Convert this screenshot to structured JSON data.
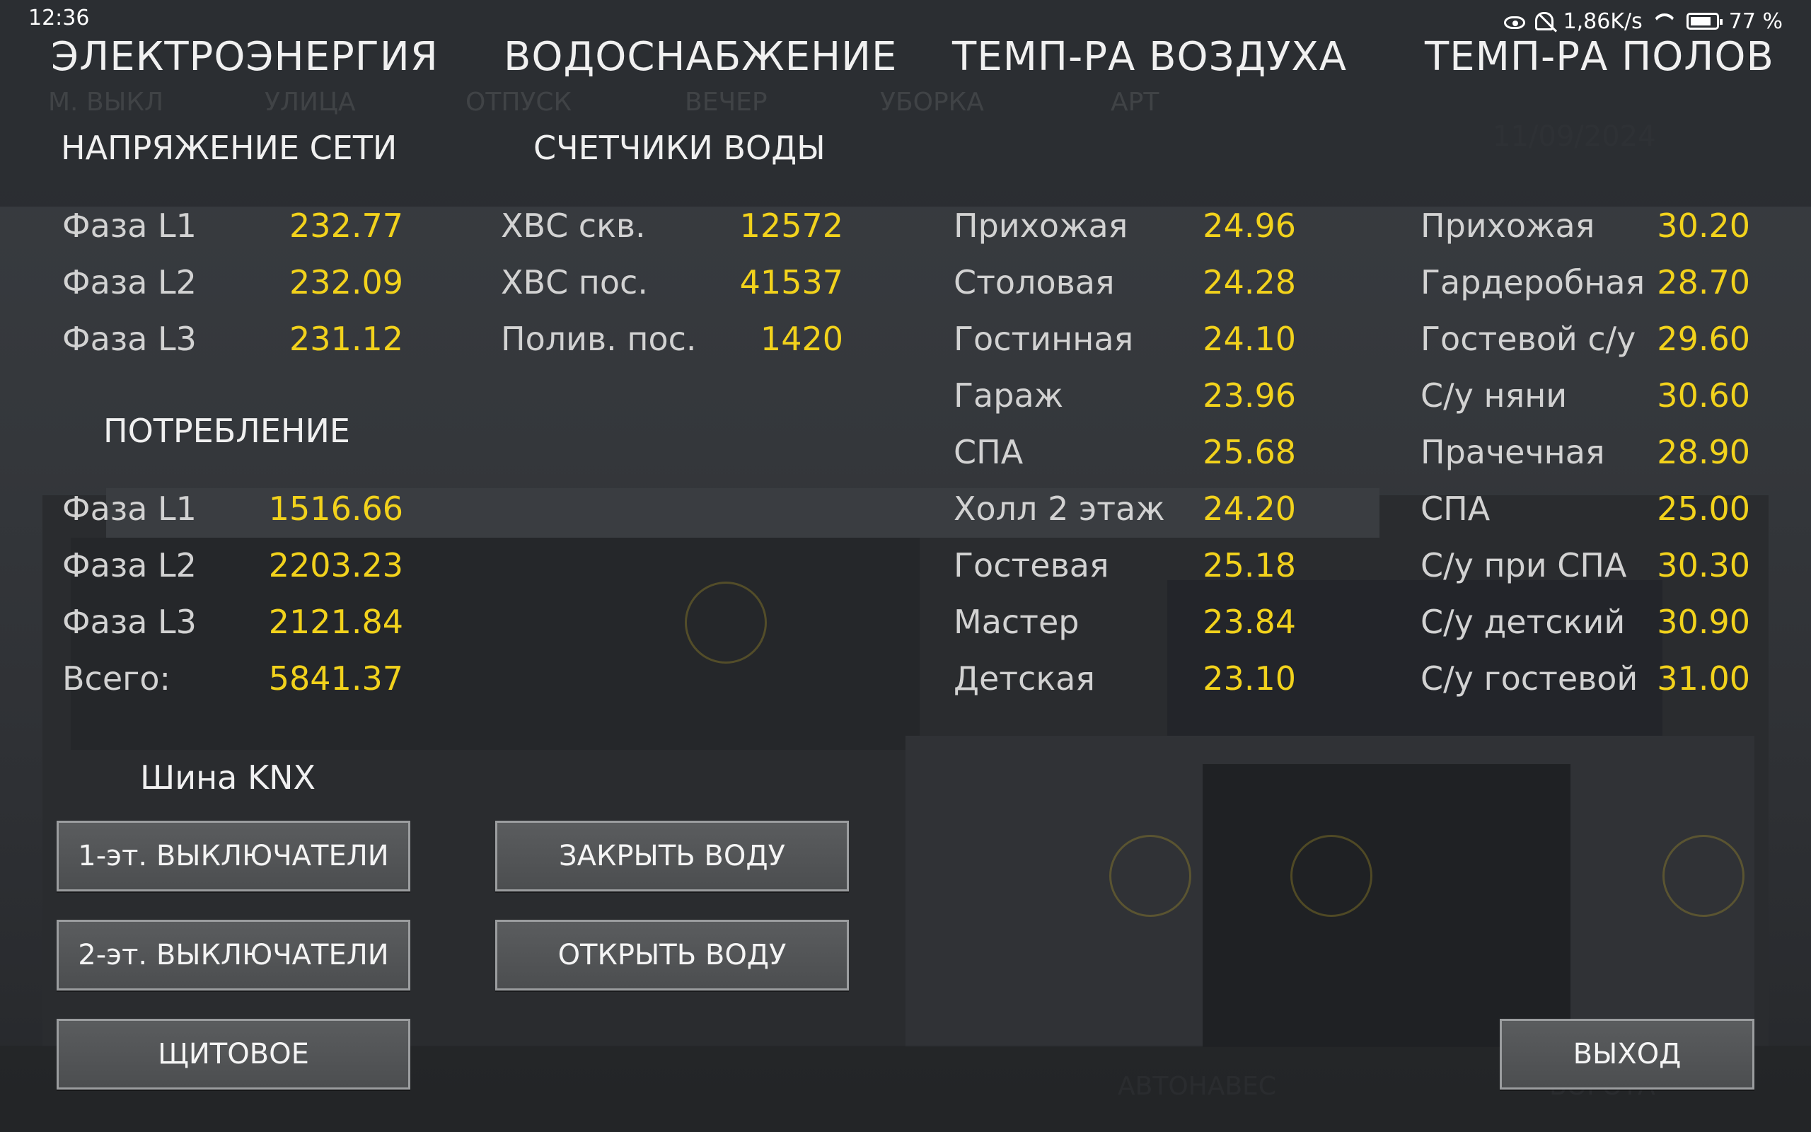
{
  "status_bar": {
    "time": "12:36",
    "net_speed": "1,86K/s",
    "battery": "77 %",
    "icons": [
      "eye-icon",
      "muted-bell-icon",
      "wifi-icon",
      "battery-icon"
    ]
  },
  "headers": {
    "electricity": "ЭЛЕКТРОЭНЕРГИЯ",
    "water": "ВОДОСНАБЖЕНИЕ",
    "air_temp": "ТЕМП-РА ВОЗДУХА",
    "floor_temp": "ТЕМП-РА ПОЛОВ"
  },
  "background_tabs": [
    "М. ВЫКЛ",
    "УЛИЦА",
    "ОТПУСК",
    "ВЕЧЕР",
    "УБОРКА",
    "АРТ"
  ],
  "voltage": {
    "title": "НАПРЯЖЕНИЕ СЕТИ",
    "rows": [
      {
        "label": "Фаза L1",
        "value": "232.77"
      },
      {
        "label": "Фаза L2",
        "value": "232.09"
      },
      {
        "label": "Фаза L3",
        "value": "231.12"
      }
    ]
  },
  "consumption": {
    "title": "ПОТРЕБЛЕНИЕ",
    "rows": [
      {
        "label": "Фаза L1",
        "value": "1516.66"
      },
      {
        "label": "Фаза L2",
        "value": "2203.23"
      },
      {
        "label": "Фаза L3",
        "value": "2121.84"
      },
      {
        "label": "Всего:",
        "value": "5841.37"
      }
    ]
  },
  "water_meters": {
    "title": "СЧЕТЧИКИ ВОДЫ",
    "rows": [
      {
        "label": "ХВС скв.",
        "value": "12572"
      },
      {
        "label": "ХВС пос.",
        "value": "41537"
      },
      {
        "label": "Полив. пос.",
        "value": "1420"
      }
    ]
  },
  "air_temps": [
    {
      "label": "Прихожая",
      "value": "24.96"
    },
    {
      "label": "Столовая",
      "value": "24.28"
    },
    {
      "label": "Гостинная",
      "value": "24.10"
    },
    {
      "label": "Гараж",
      "value": "23.96"
    },
    {
      "label": "СПА",
      "value": "25.68"
    },
    {
      "label": "Холл 2 этаж",
      "value": "24.20"
    },
    {
      "label": "Гостевая",
      "value": "25.18"
    },
    {
      "label": "Мастер",
      "value": "23.84"
    },
    {
      "label": "Детская",
      "value": "23.10"
    }
  ],
  "floor_temps": [
    {
      "label": "Прихожая",
      "value": "30.20"
    },
    {
      "label": "Гардеробная",
      "value": "28.70"
    },
    {
      "label": "Гостевой с/у",
      "value": "29.60"
    },
    {
      "label": "С/у няни",
      "value": "30.60"
    },
    {
      "label": "Прачечная",
      "value": "28.90"
    },
    {
      "label": "СПА",
      "value": "25.00"
    },
    {
      "label": "С/у при СПА",
      "value": "30.30"
    },
    {
      "label": "С/у детский",
      "value": "30.90"
    },
    {
      "label": "С/у гостевой",
      "value": "31.00"
    }
  ],
  "knx": {
    "title": "Шина KNX"
  },
  "buttons": {
    "floor1": "1-эт. ВЫКЛЮЧАТЕЛИ",
    "floor2": "2-эт. ВЫКЛЮЧАТЕЛИ",
    "panel": "ЩИТОВОЕ",
    "close_water": "ЗАКРЫТЬ ВОДУ",
    "open_water": "ОТКРЫТЬ ВОДУ",
    "exit": "ВЫХОД"
  },
  "colors": {
    "value_yellow": "#f2d21c",
    "label_gray": "#d2d2d2"
  }
}
